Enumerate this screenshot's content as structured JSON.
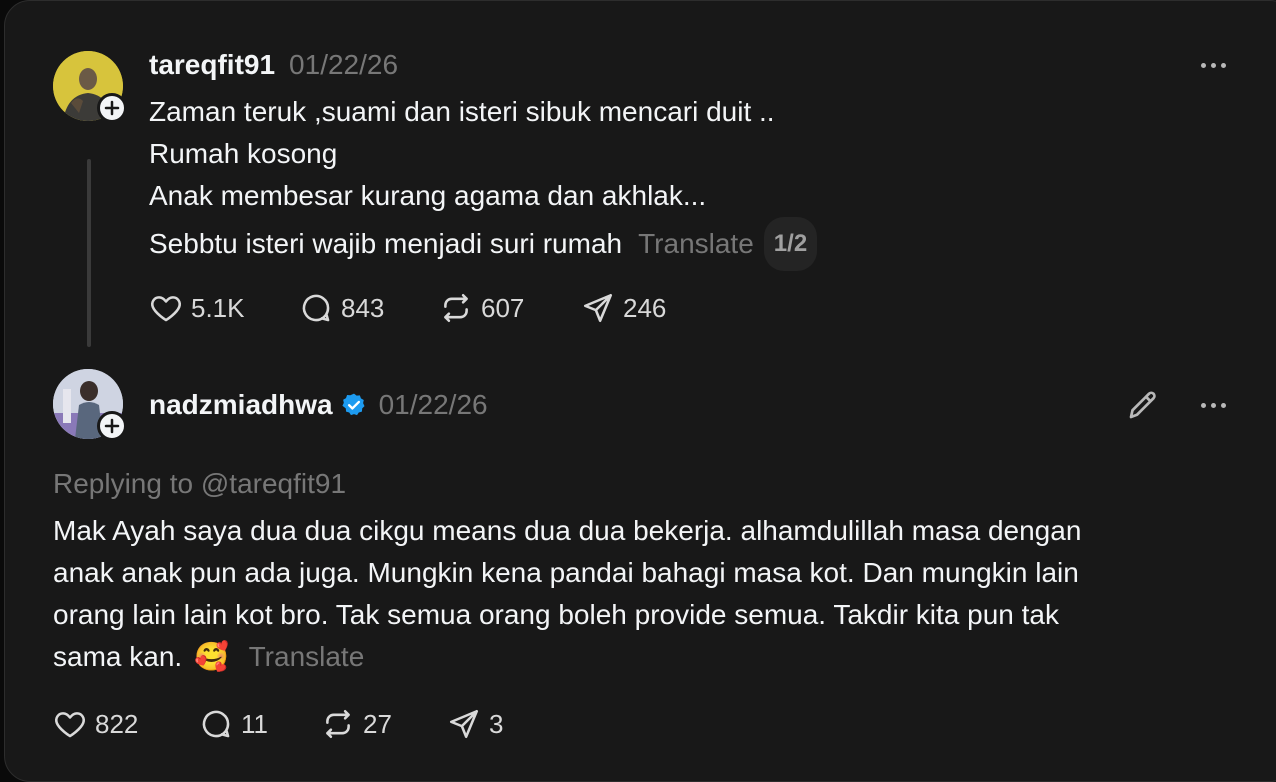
{
  "post": {
    "username": "tareqfit91",
    "date": "01/22/26",
    "lines": [
      "Zaman teruk ,suami dan isteri sibuk mencari duit ..",
      "Rumah kosong",
      "Anak membesar kurang agama dan akhlak...",
      "Sebbtu isteri wajib menjadi suri rumah"
    ],
    "translate_label": "Translate",
    "page_indicator": "1/2",
    "likes": "5.1K",
    "replies": "843",
    "reposts": "607",
    "shares": "246"
  },
  "reply": {
    "username": "nadzmiadhwa",
    "verified": true,
    "date": "01/22/26",
    "replying_to": "Replying to @tareqfit91",
    "lines": [
      "Mak Ayah saya dua dua cikgu means dua dua bekerja. alhamdulillah masa dengan",
      "anak anak pun ada juga. Mungkin kena pandai bahagi masa kot. Dan mungkin lain",
      "orang lain lain kot bro. Tak semua orang boleh provide semua. Takdir kita pun tak",
      "sama kan."
    ],
    "emoji": "🥰",
    "translate_label": "Translate",
    "likes": "822",
    "replies": "11",
    "reposts": "27",
    "shares": "3"
  },
  "colors": {
    "background": "#181818",
    "text": "#f3f5f7",
    "muted": "#777777",
    "verified": "#1d9bf0",
    "avatar1": "#d7c43c"
  },
  "icons": [
    "more-icon",
    "heart-icon",
    "comment-icon",
    "repost-icon",
    "share-icon",
    "edit-pencil-icon",
    "verified-badge-icon",
    "follow-plus-icon"
  ]
}
